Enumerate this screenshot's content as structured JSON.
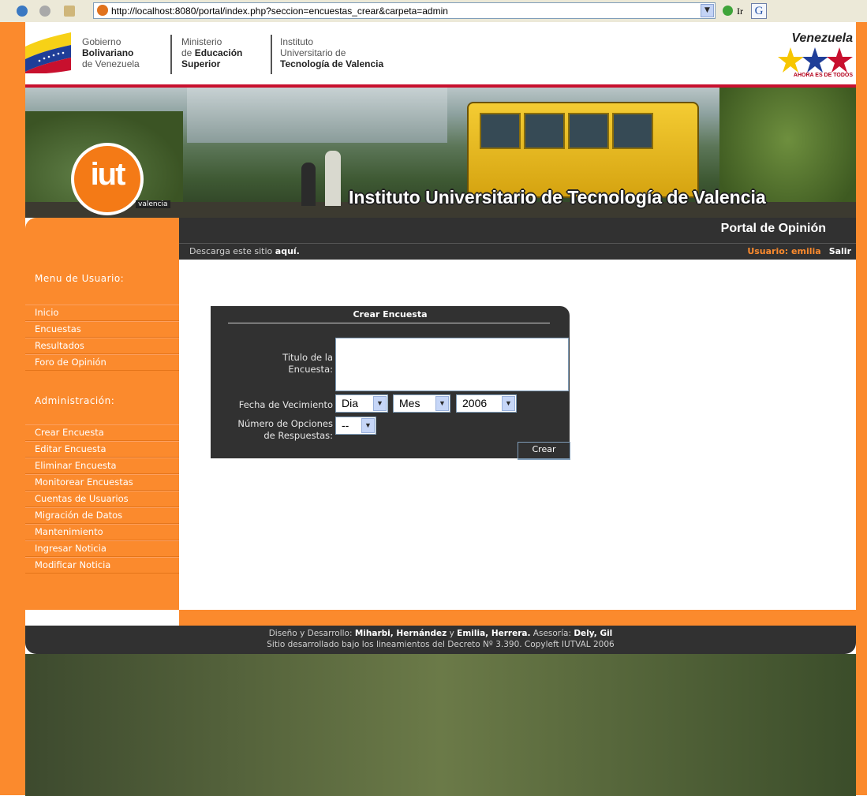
{
  "browser": {
    "url": "http://localhost:8080/portal/index.php?seccion=encuestas_crear&carpeta=admin",
    "go_label": "Ir"
  },
  "header": {
    "gov_line1": "Gobierno",
    "gov_line2": "Bolivariano",
    "gov_line3": "de Venezuela",
    "min_line1": "Ministerio",
    "min_line2a": "de ",
    "min_line2b": "Educación",
    "min_line3": "Superior",
    "inst_line1": "Instituto",
    "inst_line2": "Universitario de",
    "inst_line3": "Tecnología de Valencia",
    "vzla_title": "Venezuela",
    "vzla_slogan": "AHORA ES DE TODOS"
  },
  "banner": {
    "logo_text": "iut",
    "logo_sub": "valencia",
    "title": "Instituto Universitario de Tecnología de Valencia"
  },
  "portal": {
    "title": "Portal de Opinión",
    "download_text": "Descarga este sitio ",
    "download_link": "aquí.",
    "user_label": "Usuario: emilia",
    "logout": "Salir"
  },
  "sidebar": {
    "menu_heading": "Menu de Usuario:",
    "menu_items": [
      "Inicio",
      "Encuestas",
      "Resultados",
      "Foro de Opinión"
    ],
    "admin_heading": "Administración:",
    "admin_items": [
      "Crear Encuesta",
      "Editar Encuesta",
      "Eliminar Encuesta",
      "Monitorear Encuestas",
      "Cuentas de Usuarios",
      "Migración de Datos",
      "Mantenimiento",
      "Ingresar Noticia",
      "Modificar Noticia"
    ]
  },
  "form": {
    "title": "Crear Encuesta",
    "label_title_1": "Titulo de la",
    "label_title_2": "Encuesta:",
    "label_date": "Fecha de Vecimiento",
    "day_value": "Dia",
    "month_value": "Mes",
    "year_value": "2006",
    "label_options_1": "Número de Opciones",
    "label_options_2": "de Respuestas:",
    "options_value": "--",
    "submit": "Crear"
  },
  "footer": {
    "line1_a": "Diseño y Desarrollo: ",
    "line1_b": "Miharbi, Hernández",
    "line1_c": " y ",
    "line1_d": "Emilia, Herrera.",
    "line1_e": " Asesoría: ",
    "line1_f": "Dely, Gil",
    "line2": "Sitio desarrollado bajo los lineamientos del Decreto Nº 3.390. Copyleft IUTVAL 2006"
  },
  "colors": {
    "accent_orange": "#fb8a2d",
    "dark_bar": "#313131",
    "header_red": "#c8102e"
  }
}
